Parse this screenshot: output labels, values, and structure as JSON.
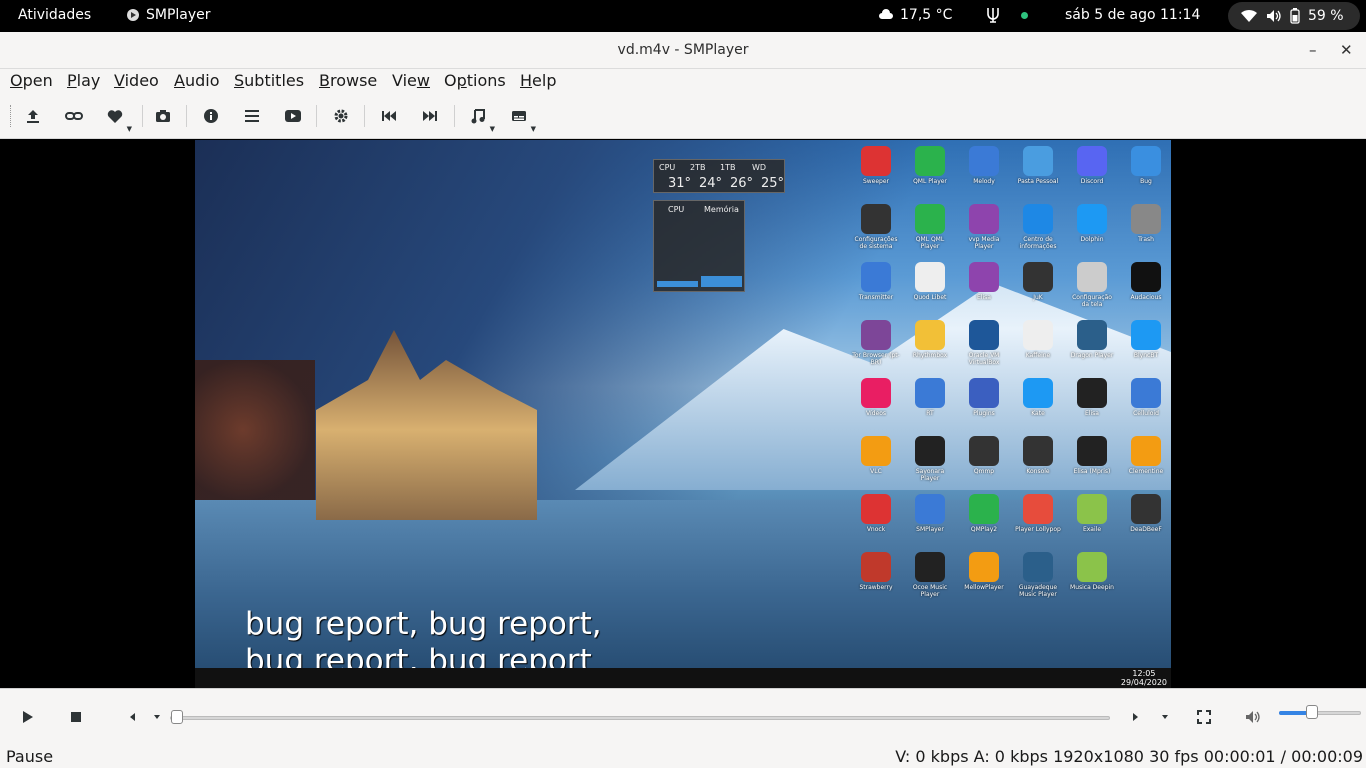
{
  "topbar": {
    "activities": "Atividades",
    "app_name": "SMPlayer",
    "temperature": "17,5 °C",
    "clock": "sáb 5 de ago  11:14",
    "battery": "59 %"
  },
  "window": {
    "title": "vd.m4v - SMPlayer",
    "minimize": "–",
    "close": "✕"
  },
  "menu": {
    "open_u": "O",
    "open": "pen",
    "play_u": "P",
    "play": "lay",
    "video_u": "V",
    "video": "ideo",
    "audio_u": "A",
    "audio": "udio",
    "subtitles_u": "S",
    "subtitles": "ubtitles",
    "browse_u": "B",
    "browse": "rowse",
    "view_pre": "Vie",
    "view_u": "w",
    "options_pre": "O",
    "options_u": "p",
    "options": "tions",
    "help_u": "H",
    "help": "elp"
  },
  "video": {
    "subtitle_line1": "bug report, bug report,",
    "subtitle_line2": "bug report, bug report",
    "widget_temps": {
      "labels": [
        "CPU",
        "2TB",
        "1TB",
        "WD"
      ],
      "values": [
        "31°",
        "24°",
        "26°",
        "25°"
      ]
    },
    "widget_usage": {
      "labels": [
        "CPU",
        "Memória"
      ],
      "levels": [
        0.08,
        0.15
      ]
    },
    "desktop_icons": [
      {
        "label": "Sweeper",
        "color": "#d33"
      },
      {
        "label": "QML Player",
        "color": "#2bb24c"
      },
      {
        "label": "Melody",
        "color": "#3b7ad6"
      },
      {
        "label": "Pasta Pessoal",
        "color": "#4a9de0"
      },
      {
        "label": "Discord",
        "color": "#5865f2"
      },
      {
        "label": "Bug",
        "color": "#3a8fe0"
      },
      {
        "label": "Configurações de sistema",
        "color": "#333"
      },
      {
        "label": "QML QML Player",
        "color": "#2bb24c"
      },
      {
        "label": "vvp Media Player",
        "color": "#8e44ad"
      },
      {
        "label": "Centro de informações",
        "color": "#1e88e5"
      },
      {
        "label": "Dolphin",
        "color": "#1d99f3"
      },
      {
        "label": "Trash",
        "color": "#888"
      },
      {
        "label": "Transmitter",
        "color": "#3b7ad6"
      },
      {
        "label": "Quod Libet",
        "color": "#eee"
      },
      {
        "label": "Elisa",
        "color": "#8e44ad"
      },
      {
        "label": "JuK",
        "color": "#333"
      },
      {
        "label": "Configuração da tela",
        "color": "#ccc"
      },
      {
        "label": "Audacious",
        "color": "#111"
      },
      {
        "label": "Tor Browser (pt-BR)",
        "color": "#7d4698"
      },
      {
        "label": "Rhythmbox",
        "color": "#f2c037"
      },
      {
        "label": "Oracle VM VirtualBox",
        "color": "#1e5799"
      },
      {
        "label": "Kaffeine",
        "color": "#eee"
      },
      {
        "label": "Dragon Player",
        "color": "#2b5f8a"
      },
      {
        "label": "BlyncBT",
        "color": "#1d99f3"
      },
      {
        "label": "Vídeos",
        "color": "#e91e63"
      },
      {
        "label": "RT",
        "color": "#3b7ad6"
      },
      {
        "label": "Plugins",
        "color": "#3b5fc0"
      },
      {
        "label": "Kate",
        "color": "#1d99f3"
      },
      {
        "label": "Elisa",
        "color": "#222"
      },
      {
        "label": "Celluloid",
        "color": "#3b7ad6"
      },
      {
        "label": "VLC",
        "color": "#f39c12"
      },
      {
        "label": "Sayonara Player",
        "color": "#222"
      },
      {
        "label": "Qmmp",
        "color": "#333"
      },
      {
        "label": "Konsole",
        "color": "#333"
      },
      {
        "label": "Elisa (Mpris)",
        "color": "#222"
      },
      {
        "label": "Clementine",
        "color": "#f39c12"
      },
      {
        "label": "Vnock",
        "color": "#d33"
      },
      {
        "label": "SMPlayer",
        "color": "#3b7ad6"
      },
      {
        "label": "QMPlay2",
        "color": "#2bb24c"
      },
      {
        "label": "Player Lollypop",
        "color": "#e74c3c"
      },
      {
        "label": "Exaile",
        "color": "#8bc34a"
      },
      {
        "label": "DeaDBeeF",
        "color": "#333"
      },
      {
        "label": "Strawberry",
        "color": "#c0392b"
      },
      {
        "label": "Ocoe Music Player",
        "color": "#222"
      },
      {
        "label": "MellowPlayer",
        "color": "#f39c12"
      },
      {
        "label": "Guayadeque Music Player",
        "color": "#2b5f8a"
      },
      {
        "label": "Musica Deepin",
        "color": "#8bc34a"
      }
    ],
    "taskbar_time": "12:05",
    "taskbar_date": "29/04/2020"
  },
  "status": {
    "state": "Pause",
    "info": "V: 0 kbps A: 0 kbps 1920x1080 30 fps   00:00:01 / 00:00:09"
  },
  "playback": {
    "position_fraction": 0.0,
    "volume_fraction": 0.4
  },
  "colors": {
    "accent": "#3584e4",
    "toolbar_bg": "#f6f5f4",
    "topbar_bg": "#000000"
  }
}
